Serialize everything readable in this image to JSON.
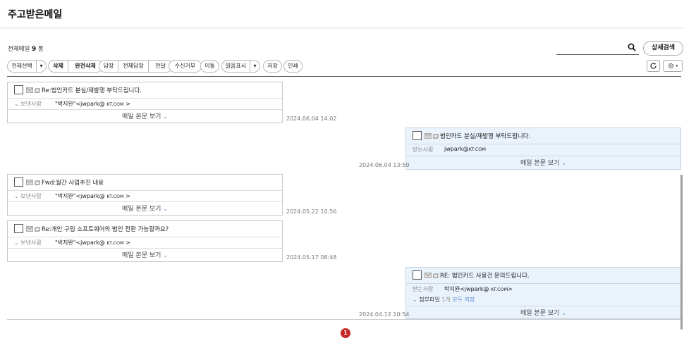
{
  "page": {
    "title": "주고받은메일",
    "count_label": "전체메일",
    "count_value": "9",
    "count_unit": "통"
  },
  "search": {
    "placeholder": "",
    "advanced_label": "상세검색"
  },
  "toolbar": {
    "select_all": "전체선택",
    "select_dropdown": "▾",
    "delete": "삭제",
    "delete_permanently": "완전삭제",
    "reply": "답장",
    "reply_all": "전체답장",
    "forward": "전달",
    "block": "수신거부",
    "move": "이동",
    "mark_read": "읽음표시",
    "mark_dropdown": "▾",
    "save": "저장",
    "print": "인쇄",
    "refresh_icon": "refresh-icon",
    "settings_icon": "gear-icon"
  },
  "messages": [
    {
      "direction": "received",
      "subject": "Re:법인카드 분실/재발행 부탁드립니다.",
      "meta_label": "보낸사람",
      "address_name": "\"박지완\"<jwpark@ ",
      "address_domain": "KT.COM",
      "address_tail": " >",
      "view_label": "메일 본문 보기",
      "date": "2024.06.04 14:02"
    },
    {
      "direction": "sent",
      "subject": "법인카드 분실/재발행 부탁드립니다.",
      "meta_label": "받는사람",
      "address_name": "jwpark@",
      "address_domain": "KT.COM",
      "address_tail": "",
      "view_label": "메일 본문 보기",
      "date": "2024.06.04 13:59"
    },
    {
      "direction": "received",
      "subject": "Fwd:월간 사업추진 내용",
      "meta_label": "보낸사람",
      "address_name": "\"박지완\"<jwpark@ ",
      "address_domain": "KT.COM",
      "address_tail": " >",
      "view_label": "메일 본문 보기",
      "date": "2024.05.22 10:56"
    },
    {
      "direction": "received",
      "subject": "Re:개인 구입 소프트웨어의 법인 전환 가능할까요?",
      "meta_label": "보낸사람",
      "address_name": "\"박지완\"<jwpark@ ",
      "address_domain": "KT.COM",
      "address_tail": " >",
      "view_label": "메일 본문 보기",
      "date": "2024.05.17 08:48"
    },
    {
      "direction": "sent",
      "subject": "RE: 법인카드 사용건 문의드립니다.",
      "meta_label": "받는사람",
      "address_name": "박지완<jwpark@ ",
      "address_domain": "KT.COM",
      "address_tail": ">",
      "attach_label": "첨부파일",
      "attach_count": "1개",
      "attach_save": "모두 저장",
      "view_label": "메일 본문 보기",
      "date": "2024.04.12 10:54"
    }
  ],
  "pagination": {
    "current": "1"
  },
  "colors": {
    "sent_card_bg": "#eaf2fb",
    "accent_blue": "#5a8fd0",
    "pager_red": "#c62828"
  }
}
